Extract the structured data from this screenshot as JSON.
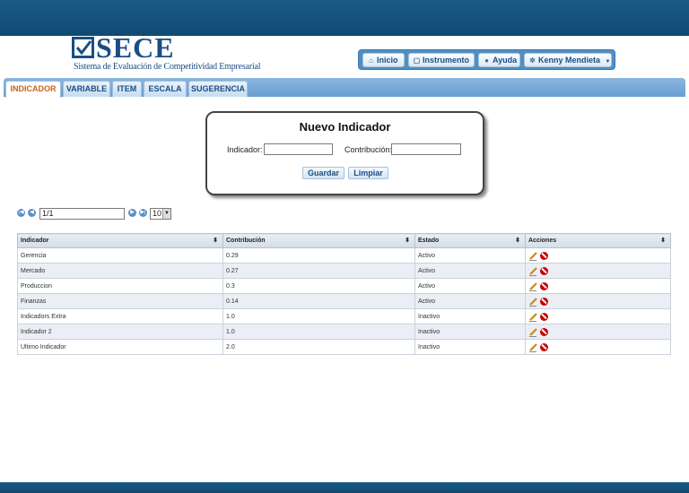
{
  "header": {
    "logo_text": "SECE",
    "logo_subtitle": "Sistema de Evaluación de Competitividad Empresarial",
    "nav": [
      {
        "label": "Inicio",
        "icon": "home-icon"
      },
      {
        "label": "Instrumento",
        "icon": "clipboard-icon"
      },
      {
        "label": "Ayuda",
        "icon": "info-icon"
      },
      {
        "label": "Kenny Mendieta",
        "icon": "gear-icon"
      }
    ]
  },
  "tabs": [
    {
      "label": "INDICADOR",
      "active": true
    },
    {
      "label": "VARIABLE",
      "active": false
    },
    {
      "label": "ITEM",
      "active": false
    },
    {
      "label": "ESCALA",
      "active": false
    },
    {
      "label": "SUGERENCIA",
      "active": false
    }
  ],
  "form": {
    "title": "Nuevo Indicador",
    "indicador_label": "Indicador:",
    "indicador_value": "",
    "contribucion_label": "Contribución:",
    "contribucion_value": "",
    "save_label": "Guardar",
    "clear_label": "Limpiar"
  },
  "pager": {
    "page": "1/1",
    "rows_per_page": "10"
  },
  "table": {
    "columns": [
      "Indicador",
      "Contribución",
      "Estado",
      "Acciones"
    ],
    "rows": [
      {
        "indicador": "Gerencia",
        "contribucion": "0.29",
        "estado": "Activo"
      },
      {
        "indicador": "Mercado",
        "contribucion": "0.27",
        "estado": "Activo"
      },
      {
        "indicador": "Produccion",
        "contribucion": "0.3",
        "estado": "Activo"
      },
      {
        "indicador": "Finanzas",
        "contribucion": "0.14",
        "estado": "Activo"
      },
      {
        "indicador": "Indicadors Extra",
        "contribucion": "1.0",
        "estado": "Inactivo"
      },
      {
        "indicador": "Indicador 2",
        "contribucion": "1.0",
        "estado": "Inactivo"
      },
      {
        "indicador": "Ultimo Indicador",
        "contribucion": "2.0",
        "estado": "Inactivo"
      }
    ]
  },
  "colors": {
    "header_bg": "#12507c",
    "accent": "#1b4d84",
    "active_tab_text": "#c8661a",
    "delete_red": "#cc0000"
  }
}
